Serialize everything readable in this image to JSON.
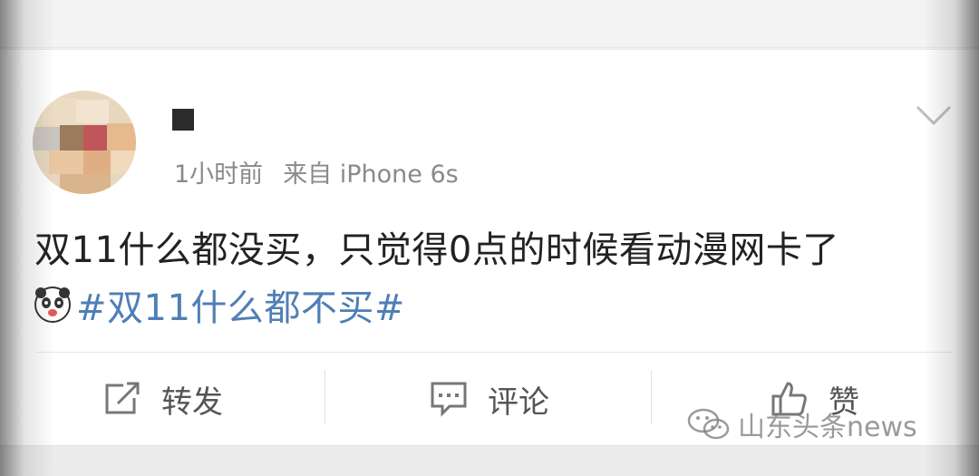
{
  "post": {
    "timestamp": "1小时前",
    "source": "来自 iPhone 6s",
    "text": "双11什么都没买，只觉得0点的时候看动漫网卡了",
    "hashtag": "#双11什么都不买#"
  },
  "actions": {
    "repost_label": "转发",
    "comment_label": "评论",
    "like_label": "赞"
  },
  "watermark": {
    "text": "山东头条news"
  },
  "icons": {
    "repost": "share-square-arrow-icon",
    "comment": "speech-bubble-icon",
    "like": "thumbs-up-icon",
    "more": "chevron-down-icon",
    "emoji": "panda-face-emoji-icon",
    "watermark": "wechat-icon"
  },
  "colors": {
    "hashtag": "#4e7fb6",
    "body_text": "#222222",
    "meta_text": "#8a8a8a",
    "action_text": "#555555"
  }
}
